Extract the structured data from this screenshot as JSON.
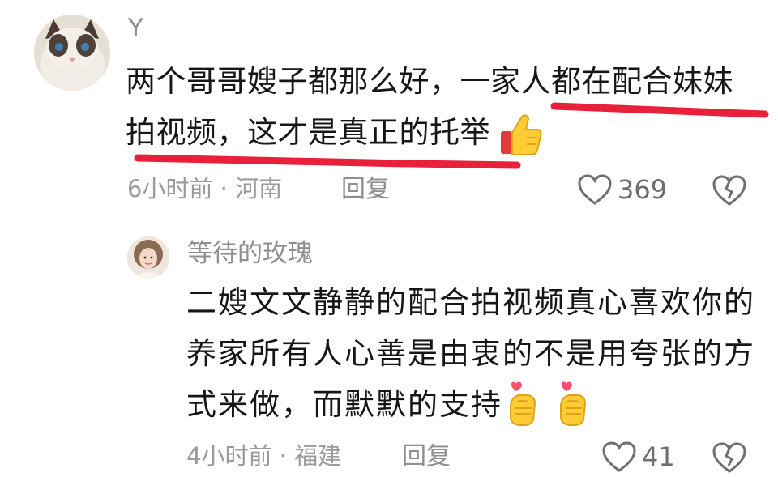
{
  "comment": {
    "username": "Y",
    "text_line1": "两个哥哥嫂子都那么好，一家人都在配合妹妹",
    "text_line2": "拍视频，这才是真正的托举",
    "time_location": "6小时前 · 河南",
    "reply_label": "回复",
    "likes": "369",
    "avatar_icon": "cat-avatar-icon",
    "emoji_icon": "thumbs-up-icon",
    "highlight_color": "#e8203a",
    "reply": {
      "username": "等待的玫瑰",
      "text_line1": "二嫂文文静静的配合拍视频真心喜欢你的",
      "text_line2": "养家所有人心善是由衷的不是用夸张的方",
      "text_line3": "式来做，而默默的支持",
      "time_location": "4小时前 · 福建",
      "reply_label": "回复",
      "likes": "41",
      "avatar_icon": "woman-avatar-icon",
      "emoji_icon": "hand-heart-icon"
    }
  }
}
